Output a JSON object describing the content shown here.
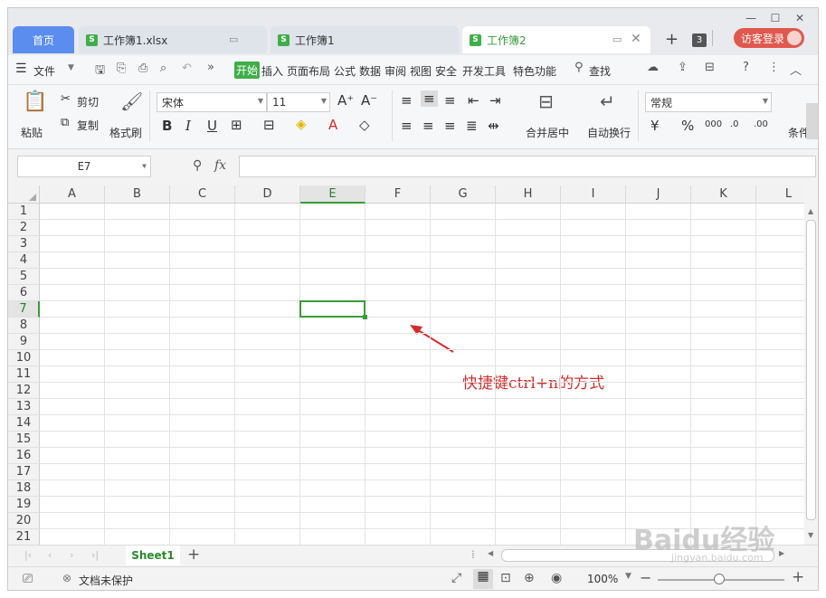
{
  "tabs": {
    "home": "首页",
    "docs": [
      {
        "label": "工作簿1.xlsx"
      },
      {
        "label": "工作簿1"
      },
      {
        "label": "工作簿2"
      }
    ],
    "tab_count": "3",
    "login": "访客登录"
  },
  "menu": {
    "file": "文件",
    "items": [
      "开始",
      "插入",
      "页面布局",
      "公式",
      "数据",
      "审阅",
      "视图",
      "安全",
      "开发工具",
      "特色功能"
    ],
    "active": "开始",
    "search": "查找"
  },
  "ribbon": {
    "paste": "粘贴",
    "cut": "剪切",
    "copy": "复制",
    "format_painter": "格式刷",
    "font_name": "宋体",
    "font_size": "11",
    "merge": "合并居中",
    "wrap": "自动换行",
    "number_format": "常规",
    "cond": "条件"
  },
  "formula": {
    "cell_ref": "E7",
    "fx": "fx",
    "value": ""
  },
  "grid": {
    "columns": [
      "A",
      "B",
      "C",
      "D",
      "E",
      "F",
      "G",
      "H",
      "I",
      "J",
      "K",
      "L"
    ],
    "rows": [
      "1",
      "2",
      "3",
      "4",
      "5",
      "6",
      "7",
      "8",
      "9",
      "10",
      "11",
      "12",
      "13",
      "14",
      "15",
      "16",
      "17",
      "18",
      "19",
      "20",
      "21"
    ],
    "selected_col": "E",
    "selected_row": "7"
  },
  "annotation": "快捷键ctrl+n的方式",
  "sheet": {
    "tab": "Sheet1",
    "add": "+"
  },
  "status": {
    "protect": "文档未保护",
    "zoom": "100%"
  },
  "watermark": "Baidu经验",
  "watermark_sub": "jingyan.baidu.com",
  "colors": {
    "accent_green": "#3fae49",
    "home_tab_blue": "#5b8def",
    "login_red": "#e0584e",
    "annotation_red": "#d32b2b"
  }
}
